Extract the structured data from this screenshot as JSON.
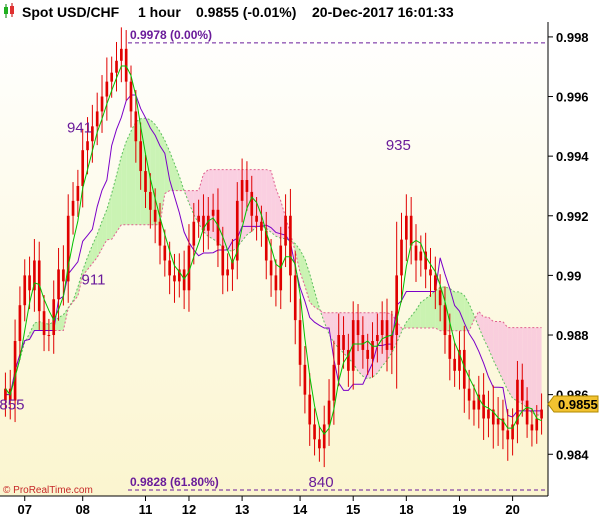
{
  "header": {
    "instrument": "Spot USD/CHF",
    "timeframe": "1 hour",
    "last_change": "0.9855 (-0.01%)",
    "datetime": "20-Dec-2017 16:01:33"
  },
  "credit": "© ProRealTime.com",
  "colors": {
    "background_top": "#ffffff",
    "background_bottom": "#fbf5cf",
    "candle_up": "#e00000",
    "candle_down": "#e00000",
    "fast_ma": "#00c000",
    "slow_line": "#7b00c8",
    "cloud_bull": "#b8f0a0",
    "cloud_bear": "#f8c0dc",
    "cloud_edge_green": "#60c060",
    "cloud_edge_red": "#e06090",
    "annotation": "#6a1b9a",
    "price_box": "#f2c230"
  },
  "chart_data": {
    "type": "candlestick",
    "title": "Spot USD/CHF",
    "ylim": [
      0.9826,
      0.9985
    ],
    "y_ticks": [
      0.984,
      0.986,
      0.988,
      0.99,
      0.992,
      0.994,
      0.996,
      0.998
    ],
    "y_tick_labels": [
      "0.984",
      "0.986",
      "0.988",
      "0.99",
      "0.992",
      "0.994",
      "0.996",
      "0.998"
    ],
    "x_ticks": [
      "07",
      "08",
      "11",
      "12",
      "13",
      "14",
      "15",
      "18",
      "19",
      "20"
    ],
    "x_tick_pos": [
      4,
      16,
      29,
      38,
      49,
      61,
      72,
      83,
      94,
      105
    ],
    "bar_count": 112,
    "last_price": "0.9855",
    "annotations": [
      {
        "label": "978",
        "x": 24,
        "y": 0.9985
      },
      {
        "label": "941",
        "x": 14,
        "y": 0.9948
      },
      {
        "label": "911",
        "x": 17,
        "y": 0.9897
      },
      {
        "label": "855",
        "x": 0,
        "y": 0.9855
      },
      {
        "label": "935",
        "x": 80,
        "y": 0.9942
      },
      {
        "label": "840",
        "x": 64,
        "y": 0.9829
      }
    ],
    "fib_levels": [
      {
        "label": "0.9978 (0.00%)",
        "value": 0.9978
      },
      {
        "label": "0.9828 (61.80%)",
        "value": 0.9828
      }
    ],
    "close": [
      0.9862,
      0.9858,
      0.9878,
      0.989,
      0.99,
      0.9895,
      0.9905,
      0.9888,
      0.988,
      0.988,
      0.9892,
      0.9902,
      0.9898,
      0.992,
      0.9925,
      0.993,
      0.9942,
      0.9945,
      0.995,
      0.9955,
      0.996,
      0.9965,
      0.9968,
      0.9972,
      0.9976,
      0.9965,
      0.9955,
      0.9945,
      0.9935,
      0.9928,
      0.9922,
      0.9918,
      0.991,
      0.9905,
      0.99,
      0.9898,
      0.9902,
      0.9895,
      0.991,
      0.9918,
      0.992,
      0.9915,
      0.992,
      0.9922,
      0.991,
      0.99,
      0.9902,
      0.9905,
      0.9925,
      0.9932,
      0.9928,
      0.992,
      0.9918,
      0.9915,
      0.9905,
      0.99,
      0.9895,
      0.991,
      0.992,
      0.99,
      0.9885,
      0.987,
      0.986,
      0.985,
      0.9845,
      0.9842,
      0.985,
      0.9858,
      0.987,
      0.988,
      0.9875,
      0.9868,
      0.9885,
      0.988,
      0.9875,
      0.9872,
      0.9878,
      0.988,
      0.9885,
      0.9875,
      0.988,
      0.99,
      0.9912,
      0.992,
      0.991,
      0.9905,
      0.9908,
      0.9902,
      0.99,
      0.9895,
      0.989,
      0.988,
      0.9872,
      0.9868,
      0.9875,
      0.9862,
      0.9858,
      0.9855,
      0.986,
      0.9852,
      0.9855,
      0.985,
      0.9852,
      0.9848,
      0.9845,
      0.985,
      0.9865,
      0.9858,
      0.985,
      0.9848,
      0.9852,
      0.9855
    ],
    "range": [
      0.0012,
      0.0014,
      0.0016,
      0.0014,
      0.0012,
      0.0014,
      0.0016,
      0.0014,
      0.0012,
      0.0012,
      0.0014,
      0.0016,
      0.0018,
      0.0016,
      0.0014,
      0.0012,
      0.0016,
      0.0018,
      0.0016,
      0.0014,
      0.0016,
      0.0018,
      0.0012,
      0.0014,
      0.0016,
      0.0014,
      0.0012,
      0.0016,
      0.0014,
      0.0012,
      0.0014,
      0.0016,
      0.0014,
      0.0012,
      0.0014,
      0.0016,
      0.0012,
      0.0014,
      0.0016,
      0.0014,
      0.0012,
      0.0016,
      0.0014,
      0.0012,
      0.0016,
      0.0014,
      0.0012,
      0.0016,
      0.0014,
      0.0016,
      0.0014,
      0.0012,
      0.0014,
      0.0012,
      0.0014,
      0.0016,
      0.0012,
      0.0014,
      0.0016,
      0.002,
      0.0018,
      0.0016,
      0.0014,
      0.0016,
      0.0012,
      0.001,
      0.0014,
      0.0016,
      0.0018,
      0.0016,
      0.0014,
      0.0012,
      0.0014,
      0.0012,
      0.0014,
      0.0012,
      0.0014,
      0.0016,
      0.0014,
      0.0016,
      0.0018,
      0.004,
      0.002,
      0.0016,
      0.0014,
      0.0016,
      0.0012,
      0.0014,
      0.0016,
      0.0014,
      0.0012,
      0.0014,
      0.0016,
      0.0012,
      0.0014,
      0.0018,
      0.0014,
      0.0012,
      0.0014,
      0.0016,
      0.0014,
      0.0018,
      0.0016,
      0.0014,
      0.0016,
      0.0012,
      0.0014,
      0.0012,
      0.001,
      0.0012,
      0.001,
      0.0012
    ]
  }
}
